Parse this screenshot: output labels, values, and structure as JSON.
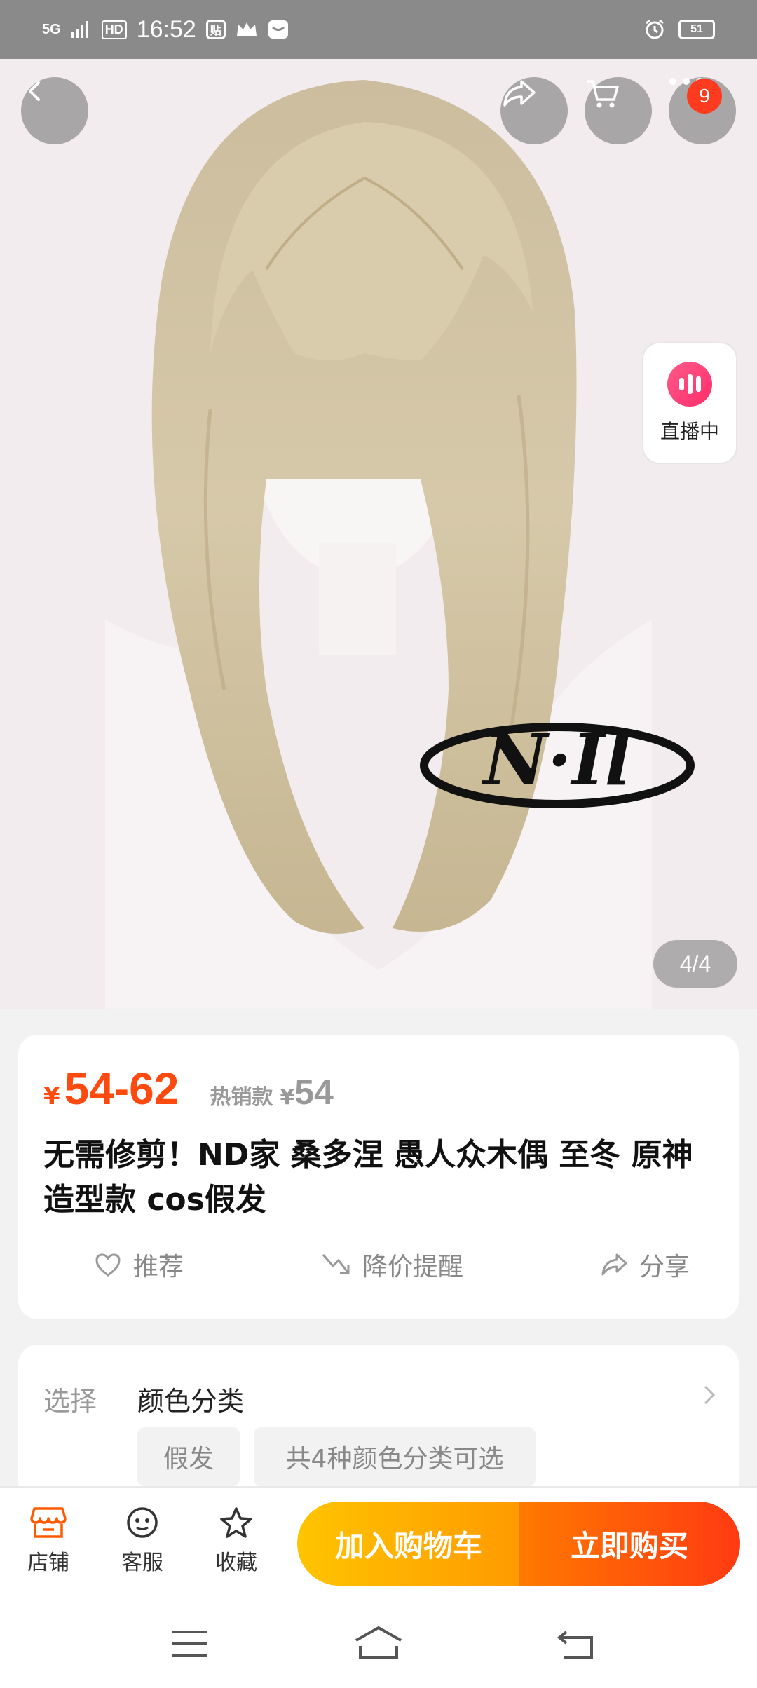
{
  "status_bar": {
    "network": "5G",
    "hd": "HD",
    "time": "16:52",
    "app_icon_1": "贴",
    "battery": "51"
  },
  "header": {
    "cart_badge": "9"
  },
  "live": {
    "label": "直播中"
  },
  "gallery": {
    "counter": "4/4",
    "watermark": "N·Il"
  },
  "price": {
    "currency": "¥",
    "range": "54-62",
    "hot_label": "热销款",
    "hot_currency": "¥",
    "hot_price": "54"
  },
  "product": {
    "title": "无需修剪！ND家 桑多涅 愚人众木偶 至冬 原神 造型款 cos假发"
  },
  "actions": {
    "recommend": "推荐",
    "price_alert": "降价提醒",
    "share": "分享"
  },
  "options": {
    "label": "选择",
    "title": "颜色分类",
    "chip_1": "假发",
    "chip_2": "共4种颜色分类可选"
  },
  "bottom_bar": {
    "shop": "店铺",
    "service": "客服",
    "favorite": "收藏",
    "add_to_cart": "加入购物车",
    "buy_now": "立即购买"
  },
  "colors": {
    "accent": "#ff4a0f",
    "cart_button": "#ffb300",
    "buy_button": "#ff4a12"
  }
}
